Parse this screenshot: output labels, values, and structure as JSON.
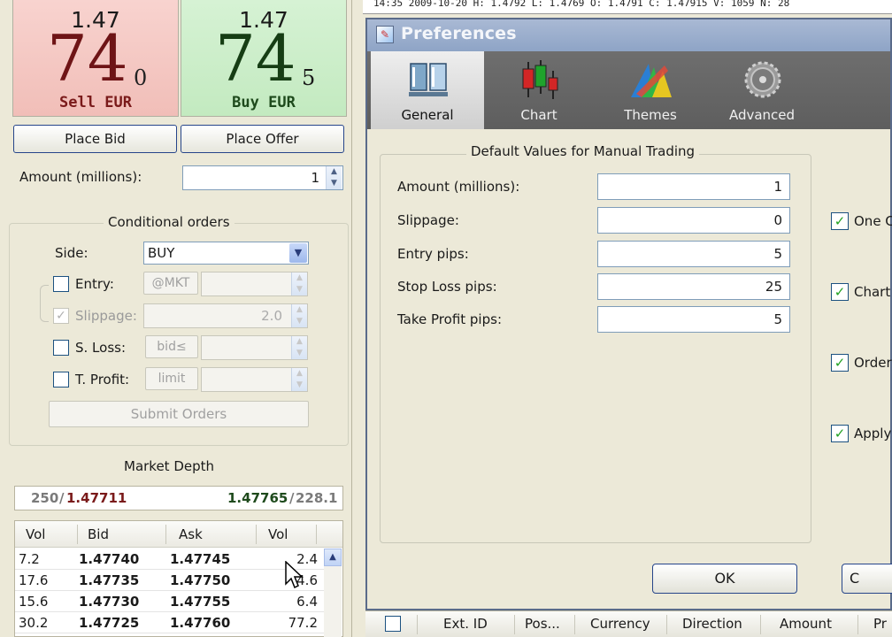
{
  "sell": {
    "small": "1.47",
    "big": "74",
    "pip": "0",
    "label": "Sell EUR"
  },
  "buy": {
    "small": "1.47",
    "big": "74",
    "pip": "5",
    "label": "Buy EUR"
  },
  "buttons": {
    "place_bid": "Place Bid",
    "place_offer": "Place Offer",
    "submit_orders": "Submit Orders"
  },
  "amount": {
    "label": "Amount (millions):",
    "value": "1"
  },
  "conditional": {
    "title": "Conditional orders",
    "side_label": "Side:",
    "side_value": "BUY",
    "entry_label": "Entry:",
    "entry_mode": "@MKT",
    "slippage_label": "Slippage:",
    "slippage_value": "2.0",
    "sloss_label": "S. Loss:",
    "sloss_mode": "bid≤",
    "tprofit_label": "T. Profit:",
    "tprofit_mode": "limit"
  },
  "depth": {
    "title": "Market Depth",
    "bid_vol": "250",
    "bid_price": "1.47711",
    "ask_price": "1.47765",
    "ask_vol": "228.1",
    "headers": [
      "Vol",
      "Bid",
      "Ask",
      "Vol"
    ],
    "rows": [
      [
        "7.2",
        "1.47740",
        "1.47745",
        "2.4"
      ],
      [
        "17.6",
        "1.47735",
        "1.47750",
        "4.6"
      ],
      [
        "15.6",
        "1.47730",
        "1.47755",
        "6.4"
      ],
      [
        "30.2",
        "1.47725",
        "1.47760",
        "77.2"
      ]
    ]
  },
  "chart_strip": "14:35 2009-10-20 H: 1.4792 L: 1.4769 O: 1.4791 C: 1.47915 V: 1059 N: 28",
  "dialog": {
    "title": "Preferences",
    "tabs": [
      "General",
      "Chart",
      "Themes",
      "Advanced"
    ],
    "frame_title": "Default Values for Manual Trading",
    "fields": [
      {
        "label": "Amount (millions):",
        "value": "1"
      },
      {
        "label": "Slippage:",
        "value": "0"
      },
      {
        "label": "Entry pips:",
        "value": "5"
      },
      {
        "label": "Stop Loss pips:",
        "value": "25"
      },
      {
        "label": "Take Profit pips:",
        "value": "5"
      }
    ],
    "right_options": [
      "One C",
      "Chart",
      "Order",
      "Apply"
    ],
    "ok": "OK",
    "cancel": "C"
  },
  "orders_columns": [
    "Ext. ID",
    "Pos...",
    "Currency",
    "Direction",
    "Amount",
    "Pr"
  ],
  "colors": {
    "sell_bg": "#f4c8c2",
    "buy_bg": "#cdeeca",
    "sell_text": "#6e1416",
    "buy_text": "#163d14",
    "toolbar": "#666666"
  }
}
